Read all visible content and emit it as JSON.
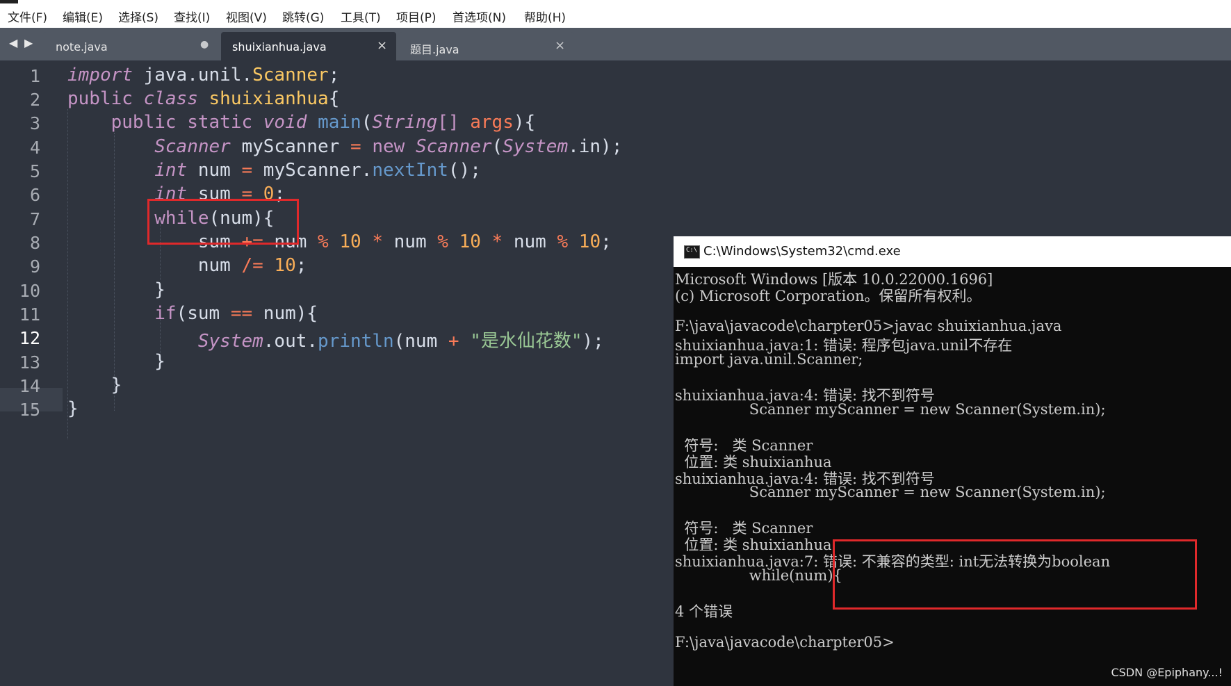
{
  "menu": [
    "文件(F)",
    "编辑(E)",
    "选择(S)",
    "查找(I)",
    "视图(V)",
    "跳转(G)",
    "工具(T)",
    "项目(P)",
    "首选项(N)",
    "帮助(H)"
  ],
  "nav": {
    "back": "◀",
    "forward": "▶"
  },
  "tabs": [
    {
      "label": "note.java",
      "ctl": "●",
      "active": false
    },
    {
      "label": "shuixianhua.java",
      "ctl": "×",
      "active": true
    },
    {
      "label": "题目.java",
      "ctl": "×",
      "active": false
    }
  ],
  "current_line": 12,
  "code": {
    "line_numbers": [
      "1",
      "2",
      "3",
      "4",
      "5",
      "6",
      "7",
      "8",
      "9",
      "10",
      "11",
      "12",
      "13",
      "14",
      "15"
    ],
    "l1": [
      "import",
      " java.unil.",
      "Scanner",
      ";"
    ],
    "l2": [
      "public",
      " ",
      "class",
      " ",
      "shuixianhua",
      "{"
    ],
    "l3": [
      "    ",
      "public",
      " ",
      "static",
      " ",
      "void",
      " ",
      "main",
      "(",
      "String",
      "[] ",
      "args",
      "){"
    ],
    "l4": [
      "        ",
      "Scanner",
      " myScanner ",
      "=",
      " ",
      "new",
      " ",
      "Scanner",
      "(",
      "System",
      ".in);"
    ],
    "l5": [
      "        ",
      "int",
      " num ",
      "=",
      " myScanner.",
      "nextInt",
      "();"
    ],
    "l6": [
      "        ",
      "int",
      " sum ",
      "=",
      " ",
      "0",
      ";"
    ],
    "l7": [
      "        ",
      "while",
      "(num){"
    ],
    "l8": [
      "            sum ",
      "+=",
      " num ",
      "%",
      " ",
      "10",
      " ",
      "*",
      " num ",
      "%",
      " ",
      "10",
      " ",
      "*",
      " num ",
      "%",
      " ",
      "10",
      ";"
    ],
    "l9": [
      "            num ",
      "/=",
      " ",
      "10",
      ";"
    ],
    "l10": [
      "        }"
    ],
    "l11": [
      "        ",
      "if",
      "(sum ",
      "==",
      " num){"
    ],
    "l12": [
      "            ",
      "System",
      ".out.",
      "println",
      "(num ",
      "+",
      " ",
      "\"是水仙花数\"",
      ");"
    ],
    "l13": [
      "        }"
    ],
    "l14": [
      "    }"
    ],
    "l15": [
      "}"
    ]
  },
  "cmd": {
    "title": "C:\\Windows\\System32\\cmd.exe",
    "lines": [
      "Microsoft Windows [版本 10.0.22000.1696]",
      "(c) Microsoft Corporation。保留所有权利。",
      "",
      "F:\\java\\javacode\\charpter05>javac shuixianhua.java",
      "shuixianhua.java:1: 错误: 程序包java.unil不存在",
      "import java.unil.Scanner;",
      "",
      "shuixianhua.java:4: 错误: 找不到符号",
      "                Scanner myScanner = new Scanner(System.in);",
      "",
      "  符号:   类 Scanner",
      "  位置: 类 shuixianhua",
      "shuixianhua.java:4: 错误: 找不到符号",
      "                Scanner myScanner = new Scanner(System.in);",
      "",
      "  符号:   类 Scanner",
      "  位置: 类 shuixianhua",
      "shuixianhua.java:7: 错误: 不兼容的类型: int无法转换为boolean",
      "                while(num){",
      "",
      "4 个错误",
      "",
      "F:\\java\\javacode\\charpter05>"
    ]
  },
  "watermark": "CSDN @Epiphany...!",
  "colors": {
    "editor_bg": "#2f343e",
    "keyword": "#c594c5",
    "class": "#fac863",
    "function": "#6699cc",
    "operator": "#f97b58",
    "number": "#f9ae58",
    "string": "#99c794",
    "highlight_box": "#e0292b"
  }
}
